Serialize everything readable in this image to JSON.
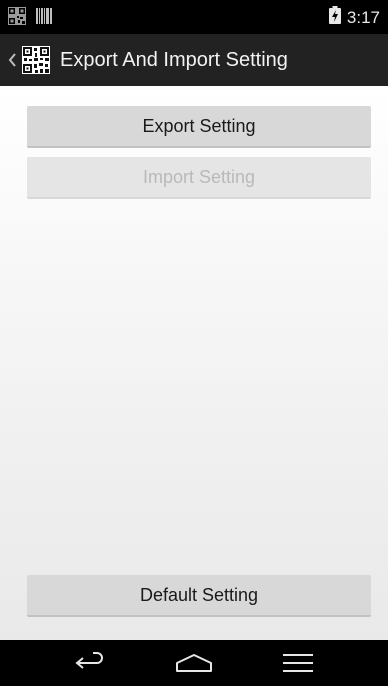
{
  "status_bar": {
    "time": "3:17",
    "left_icons": [
      "qr-code-icon",
      "barcode-icon"
    ],
    "right_icons": [
      "battery-charging-icon"
    ]
  },
  "action_bar": {
    "title": "Export And Import Setting",
    "icons": [
      "back-chevron-icon",
      "qr-code-icon"
    ]
  },
  "buttons": {
    "export_label": "Export Setting",
    "import_label": "Import Setting",
    "import_enabled": false,
    "default_label": "Default Setting"
  },
  "nav_bar": {
    "icons": [
      "back-icon",
      "home-icon",
      "recent-apps-icon"
    ]
  },
  "colors": {
    "status_bar_bg": "#000000",
    "action_bar_bg": "#222222",
    "content_bg": "#f3f3f3",
    "button_bg": "#d8d8d8",
    "disabled_text": "#b9b9b9"
  }
}
